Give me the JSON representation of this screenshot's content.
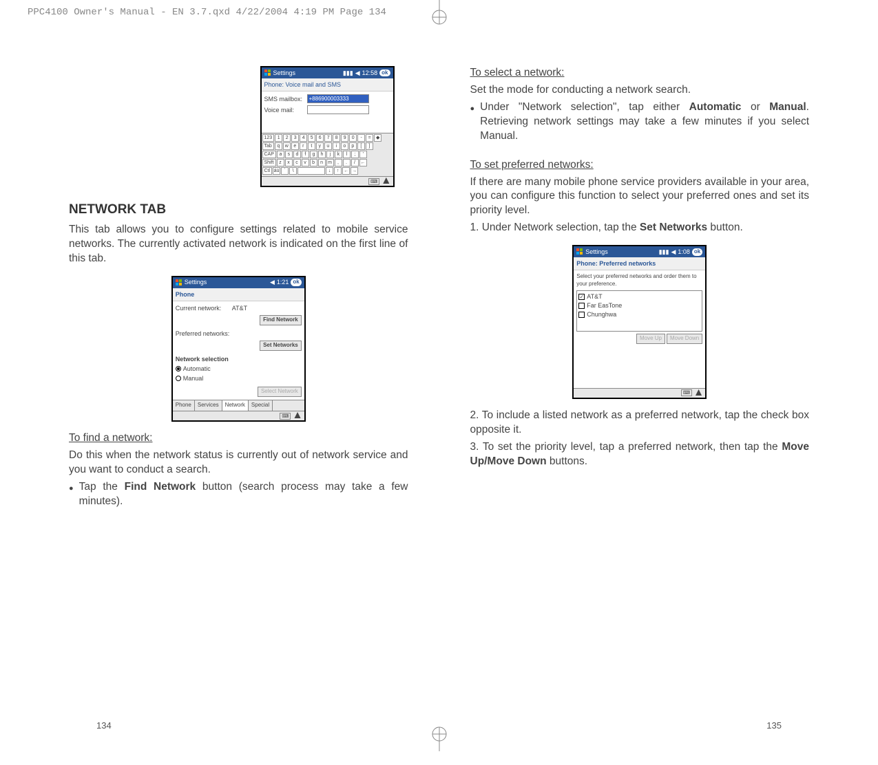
{
  "header": "PPC4100 Owner's Manual - EN 3.7.qxd  4/22/2004  4:19 PM  Page 134",
  "screenshot1": {
    "title": "Settings",
    "time": "12:58",
    "okLabel": "ok",
    "subtitle": "Phone: Voice mail and SMS",
    "smsLabel": "SMS mailbox:",
    "smsValue": "+886900003333",
    "voiceLabel": "Voice mail:",
    "kbd": {
      "r1": [
        "123",
        "1",
        "2",
        "3",
        "4",
        "5",
        "6",
        "7",
        "8",
        "9",
        "0",
        "-",
        "=",
        "◆"
      ],
      "r2": [
        "Tab",
        "q",
        "w",
        "e",
        "r",
        "t",
        "y",
        "u",
        "i",
        "o",
        "p",
        "[",
        "]"
      ],
      "r3": [
        "CAP",
        "a",
        "s",
        "d",
        "f",
        "g",
        "h",
        "j",
        "k",
        "l",
        ";",
        "'"
      ],
      "r4": [
        "Shift",
        "z",
        "x",
        "c",
        "v",
        "b",
        "n",
        "m",
        ",",
        ".",
        "/",
        "←"
      ],
      "r5": [
        "Ctl",
        "áü",
        "`",
        "\\",
        " ",
        "↓",
        "↑",
        "←",
        "→"
      ]
    }
  },
  "leftCol": {
    "heading": "NETWORK TAB",
    "intro": "This tab allows you to configure settings related to mobile service networks. The currently activated network is indicated on the first line of this tab.",
    "findHeading": "To find a network:",
    "findText": "Do this when the network status is currently out of network service and you want to conduct a search.",
    "findBulletPrefix": "Tap the ",
    "findBulletBold": "Find Network",
    "findBulletSuffix": " button (search process may take a few minutes).",
    "pageNum": "134"
  },
  "screenshot2": {
    "title": "Settings",
    "time": "1:21",
    "okLabel": "ok",
    "subtitle": "Phone",
    "currentLabel": "Current network:",
    "currentValue": "AT&T",
    "findBtn": "Find Network",
    "prefLabel": "Preferred networks:",
    "setBtn": "Set Networks",
    "sectionLabel": "Network selection",
    "radioAuto": "Automatic",
    "radioManual": "Manual",
    "selectBtn": "Select Network",
    "tabs": [
      "Phone",
      "Services",
      "Network",
      "Special"
    ]
  },
  "rightCol": {
    "selectHeading": "To select a network:",
    "selectText": "Set the mode for conducting a network search.",
    "selectBulletPrefix": "Under \"Network selection\", tap either ",
    "selectBold1": "Automatic",
    "selectMid": " or ",
    "selectBold2": "Manual",
    "selectBulletSuffix": ". Retrieving network settings may take a few minutes if you select Manual.",
    "prefHeading": "To set preferred networks:",
    "prefText": "If there are many mobile phone service providers available in your area, you can configure this function to select your preferred ones and set its priority level.",
    "step1Prefix": "1. Under Network selection, tap the ",
    "step1Bold": "Set Networks",
    "step1Suffix": " button.",
    "step2": "2. To include a listed network as a preferred network, tap the check box opposite it.",
    "step3Prefix": "3. To set the priority level, tap a preferred network, then tap the ",
    "step3Bold": "Move Up/Move Down",
    "step3Suffix": " buttons.",
    "pageNum": "135"
  },
  "screenshot3": {
    "title": "Settings",
    "time": "1:08",
    "okLabel": "ok",
    "subtitle": "Phone: Preferred networks",
    "instruction": "Select your preferred networks and order them to your preference.",
    "items": [
      {
        "name": "AT&T",
        "checked": true
      },
      {
        "name": "Far EasTone",
        "checked": false
      },
      {
        "name": "Chunghwa",
        "checked": false
      }
    ],
    "moveUp": "Move Up",
    "moveDown": "Move Down"
  }
}
